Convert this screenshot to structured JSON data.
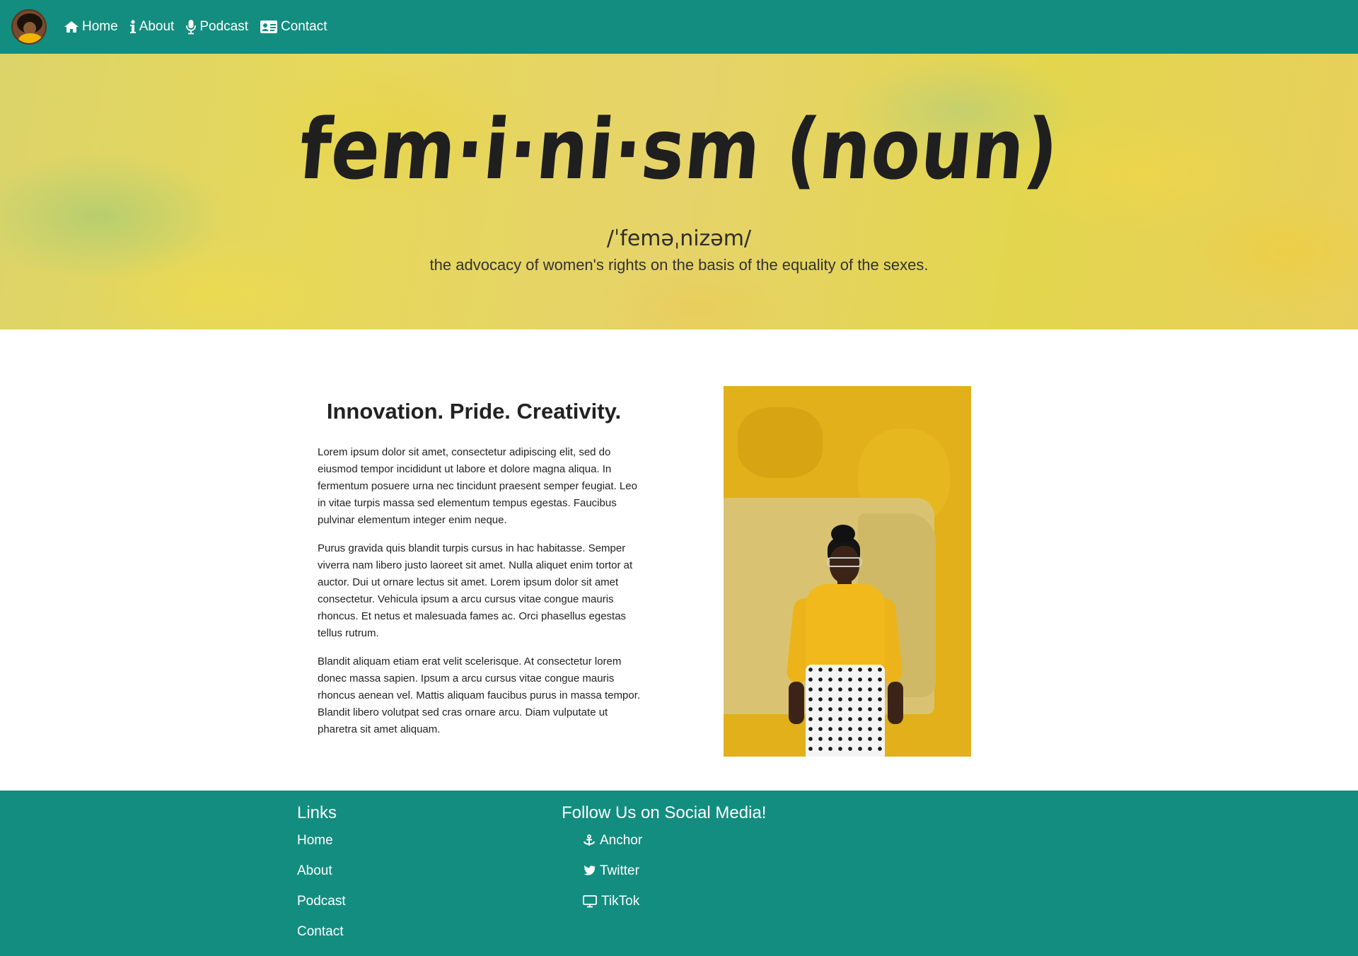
{
  "nav": {
    "items": [
      {
        "label": "Home",
        "icon": "home-icon"
      },
      {
        "label": "About",
        "icon": "info-icon"
      },
      {
        "label": "Podcast",
        "icon": "microphone-icon"
      },
      {
        "label": "Contact",
        "icon": "id-card-icon"
      }
    ]
  },
  "hero": {
    "title": "fem·i·ni·sm (noun)",
    "phonetic": "/ˈfeməˌnizəm/",
    "definition": "the advocacy of women's rights on the basis of the equality of the sexes."
  },
  "main": {
    "heading": "Innovation. Pride. Creativity.",
    "paragraphs": [
      "Lorem ipsum dolor sit amet, consectetur adipiscing elit, sed do eiusmod tempor incididunt ut labore et dolore magna aliqua. In fermentum posuere urna nec tincidunt praesent semper feugiat. Leo in vitae turpis massa sed elementum tempus egestas. Faucibus pulvinar elementum integer enim neque.",
      "Purus gravida quis blandit turpis cursus in hac habitasse. Semper viverra nam libero justo laoreet sit amet. Nulla aliquet enim tortor at auctor. Dui ut ornare lectus sit amet. Lorem ipsum dolor sit amet consectetur. Vehicula ipsum a arcu cursus vitae congue mauris rhoncus. Et netus et malesuada fames ac. Orci phasellus egestas tellus rutrum.",
      "Blandit aliquam etiam erat velit scelerisque. At consectetur lorem donec massa sapien. Ipsum a arcu cursus vitae congue mauris rhoncus aenean vel. Mattis aliquam faucibus purus in massa tempor. Blandit libero volutpat sed cras ornare arcu. Diam vulputate ut pharetra sit amet aliquam."
    ]
  },
  "footer": {
    "links_heading": "Links",
    "links": [
      "Home",
      "About",
      "Podcast",
      "Contact"
    ],
    "social_heading": "Follow Us on Social Media!",
    "social": [
      {
        "label": "Anchor",
        "icon": "anchor-icon"
      },
      {
        "label": "Twitter",
        "icon": "twitter-icon"
      },
      {
        "label": "TikTok",
        "icon": "monitor-icon"
      }
    ]
  },
  "colors": {
    "brand": "#138d80",
    "hero_yellow": "#e3d64e"
  }
}
